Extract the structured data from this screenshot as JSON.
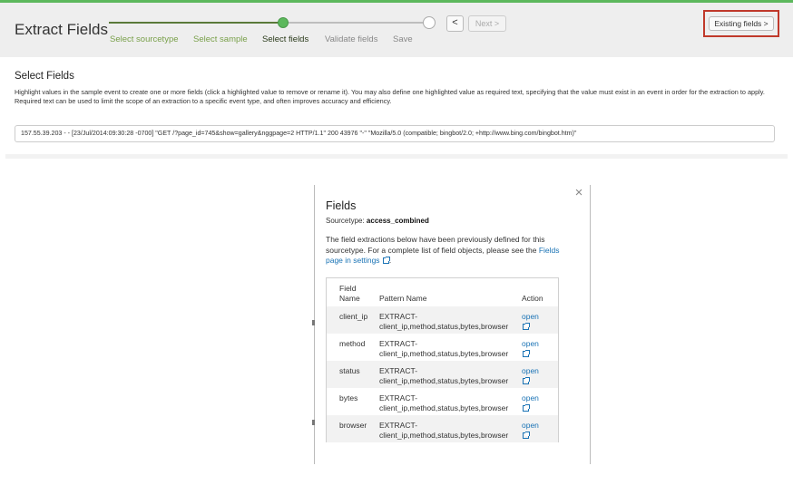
{
  "header": {
    "title": "Extract Fields",
    "steps": [
      {
        "label": "Select sourcetype",
        "state": "done"
      },
      {
        "label": "Select sample",
        "state": "done"
      },
      {
        "label": "Select fields",
        "state": "current"
      },
      {
        "label": "Validate fields",
        "state": "todo"
      },
      {
        "label": "Save",
        "state": "todo"
      }
    ],
    "prev_label": "<",
    "next_label": "Next >",
    "existing_fields_label": "Existing fields >"
  },
  "select_fields": {
    "title": "Select Fields",
    "instructions": "Highlight values in the sample event to create one or more fields (click a highlighted value to remove or rename it). You may also define one highlighted value as required text, specifying that the value must exist in an event in order for the extraction to apply. Required text can be used to limit the scope of an extraction to a specific event type, and often improves accuracy and efficiency.",
    "sample_event": "157.55.39.203 - - [23/Jul/2014:09:30:28 -0700] \"GET /?page_id=745&show=gallery&nggpage=2 HTTP/1.1\" 200 43976 \"-\" \"Mozilla/5.0 (compatible; bingbot/2.0; +http://www.bing.com/bingbot.htm)\""
  },
  "fields_modal": {
    "title": "Fields",
    "sourcetype_label": "Sourcetype: ",
    "sourcetype_value": "access_combined",
    "description": "The field extractions below have been previously defined for this sourcetype. For a complete list of field objects, please see the ",
    "settings_link": "Fields page in settings",
    "table": {
      "headers": {
        "field_name": "Field Name",
        "pattern_name": "Pattern Name",
        "action": "Action"
      },
      "rows": [
        {
          "field": "client_ip",
          "pattern": "EXTRACT-client_ip,method,status,bytes,browser",
          "action": "open"
        },
        {
          "field": "method",
          "pattern": "EXTRACT-client_ip,method,status,bytes,browser",
          "action": "open"
        },
        {
          "field": "status",
          "pattern": "EXTRACT-client_ip,method,status,bytes,browser",
          "action": "open"
        },
        {
          "field": "bytes",
          "pattern": "EXTRACT-client_ip,method,status,bytes,browser",
          "action": "open"
        },
        {
          "field": "browser",
          "pattern": "EXTRACT-client_ip,method,status,bytes,browser",
          "action": "open"
        }
      ]
    }
  },
  "icons": {
    "close": "close-icon",
    "external_link": "external-link-icon"
  },
  "colors": {
    "accent_green": "#5cb85c",
    "highlight_red": "#c0392b",
    "link_blue": "#1a73b5"
  }
}
